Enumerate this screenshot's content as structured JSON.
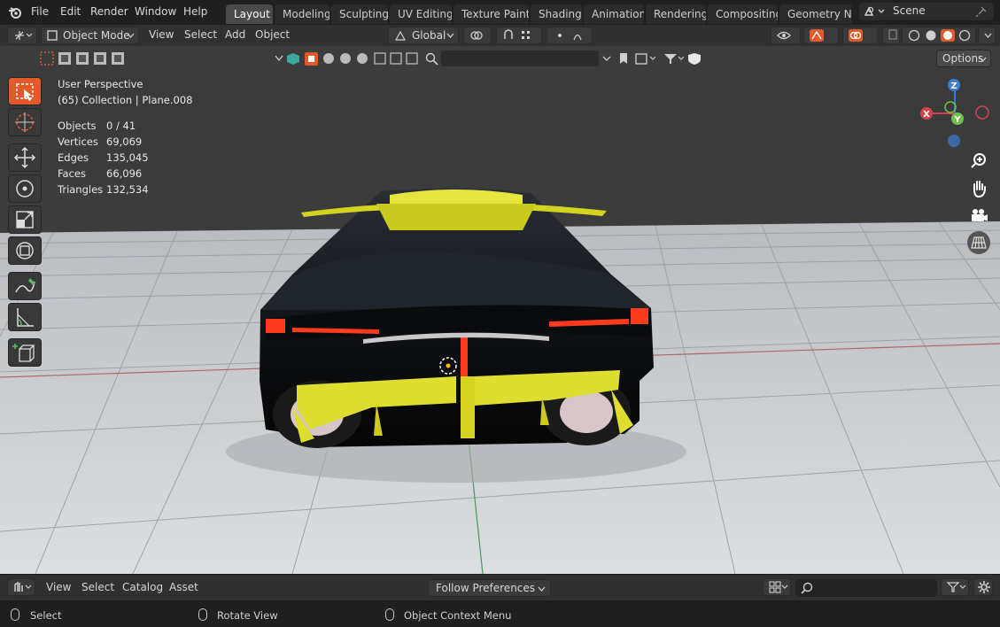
{
  "topbar": {
    "menus": [
      "File",
      "Edit",
      "Render",
      "Window",
      "Help"
    ],
    "workspaces": [
      {
        "label": "Layout",
        "active": true
      },
      {
        "label": "Modeling",
        "active": false
      },
      {
        "label": "Sculpting",
        "active": false
      },
      {
        "label": "UV Editing",
        "active": false
      },
      {
        "label": "Texture Paint",
        "active": false
      },
      {
        "label": "Shading",
        "active": false
      },
      {
        "label": "Animation",
        "active": false
      },
      {
        "label": "Rendering",
        "active": false
      },
      {
        "label": "Compositing",
        "active": false
      },
      {
        "label": "Geometry Noc",
        "active": false
      }
    ],
    "scene_name": "Scene"
  },
  "header": {
    "mode": "Object Mode",
    "menus": [
      "View",
      "Select",
      "Add",
      "Object"
    ],
    "transform_orientation": "Global"
  },
  "toolheader": {
    "options_label": "Options"
  },
  "viewport": {
    "view_name": "User Perspective",
    "collection_info": "(65) Collection | Plane.008",
    "stats": [
      {
        "label": "Objects",
        "value": "0 / 41"
      },
      {
        "label": "Vertices",
        "value": "69,069"
      },
      {
        "label": "Edges",
        "value": "135,045"
      },
      {
        "label": "Faces",
        "value": "66,096"
      },
      {
        "label": "Triangles",
        "value": "132,534"
      }
    ],
    "gizmo": {
      "x_label": "X",
      "y_label": "Y",
      "z_label": "Z"
    }
  },
  "bottombar": {
    "menus": [
      "View",
      "Select",
      "Catalog",
      "Asset"
    ],
    "import_method": "Follow Preferences"
  },
  "statusbar": {
    "items": [
      "Select",
      "Rotate View",
      "Object Context Menu"
    ]
  },
  "colors": {
    "accent": "#e25a2b",
    "active_tab": "#4a4a4a",
    "axis_x": "#d44350",
    "axis_y": "#6fc04b",
    "axis_z": "#3d7ed0"
  }
}
